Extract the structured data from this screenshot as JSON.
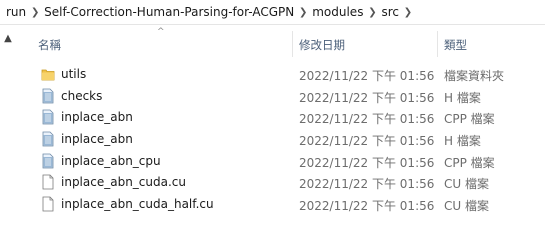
{
  "breadcrumb": {
    "items": [
      "run",
      "Self-Correction-Human-Parsing-for-ACGPN",
      "modules",
      "src"
    ]
  },
  "columns": {
    "name": "名稱",
    "date": "修改日期",
    "type": "類型"
  },
  "sort_indicator": "^",
  "files": [
    {
      "name": "utils",
      "date": "2022/11/22 下午 01:56",
      "type": "檔案資料夾",
      "icon": "folder-icon"
    },
    {
      "name": "checks",
      "date": "2022/11/22 下午 01:56",
      "type": "H 檔案",
      "icon": "source-file-icon"
    },
    {
      "name": "inplace_abn",
      "date": "2022/11/22 下午 01:56",
      "type": "CPP 檔案",
      "icon": "source-file-icon"
    },
    {
      "name": "inplace_abn",
      "date": "2022/11/22 下午 01:56",
      "type": "H 檔案",
      "icon": "source-file-icon"
    },
    {
      "name": "inplace_abn_cpu",
      "date": "2022/11/22 下午 01:56",
      "type": "CPP 檔案",
      "icon": "source-file-icon"
    },
    {
      "name": "inplace_abn_cuda.cu",
      "date": "2022/11/22 下午 01:56",
      "type": "CU 檔案",
      "icon": "blank-file-icon"
    },
    {
      "name": "inplace_abn_cuda_half.cu",
      "date": "2022/11/22 下午 01:56",
      "type": "CU 檔案",
      "icon": "blank-file-icon"
    }
  ],
  "colors": {
    "folder": "#f0c24a",
    "source_file": "#9ab8d6",
    "header_text": "#4c607a",
    "meta_text": "#6d6d6d"
  }
}
